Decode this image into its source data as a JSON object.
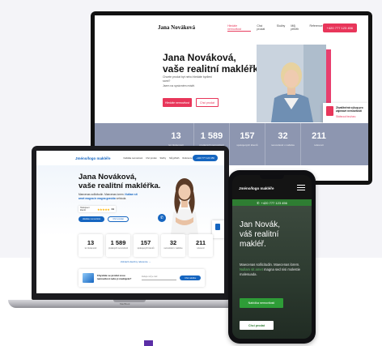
{
  "monitor": {
    "logo": "Jana Nováková",
    "nav": [
      "Hledáte nemovitost",
      "Chci prodat",
      "Služby",
      "Můj příběh",
      "Reference"
    ],
    "phone": "+420 777 123 456",
    "heading_line1": "Jana Nováková,",
    "heading_line2": "vaše realitní makléřka.",
    "sub_line1": "Chcete prodat byt nebo hledáte bydlení sami?",
    "sub_line2": "Jsem na správném místě.",
    "btn_primary": "Hledáte nemovitost",
    "btn_secondary": "Chci prodat",
    "card_text": "Zkvalitněná výkup pro zajímavé nemovitosti",
    "card_link": "Stáhnout brožuru",
    "stats": [
      {
        "value": "13",
        "label": "let zkušeností"
      },
      {
        "value": "1 589",
        "label": "prodaných nemovitostí"
      },
      {
        "value": "157",
        "label": "spokojených klientů"
      },
      {
        "value": "32",
        "label": "nemovitostí v nabídce"
      },
      {
        "value": "211",
        "label": "referencí"
      }
    ]
  },
  "laptop": {
    "logo": "Jméno/logo makléře",
    "nav": [
      "Nabídka nemovitostí",
      "Chci prodat",
      "Služby",
      "Můj příběh",
      "Reference"
    ],
    "phone": "+420 777 123 456",
    "heading_line1": "Jana Nováková,",
    "heading_line2": "vaše realitní makléřka.",
    "sub_line1": "Maecenas sollicitudin. Maecenas lorem.",
    "sub_highlight": "Nullam sit amet magna in magna gravida",
    "sub_line2": "vehicula.",
    "rating_text": "Hodnocení klientů",
    "stars": "★★★★★",
    "rating_value": "4.9",
    "btn_primary": "Hledáte nemovitost",
    "btn_secondary": "Chci prodat",
    "stats": [
      {
        "value": "13",
        "label": "let zkušeností"
      },
      {
        "value": "1 589",
        "label": "prodaných nemovitostí"
      },
      {
        "value": "157",
        "label": "spokojených klientů"
      },
      {
        "value": "32",
        "label": "nemovitostí v nabídce"
      },
      {
        "value": "211",
        "label": "referencí"
      }
    ],
    "more_link": "Zobrazit všechny reference →",
    "banner_title": "Chystáte se prodat svou nemovitost nebo ji zvažujete?",
    "banner_input": "Zadejte svůj e-mail",
    "banner_button": "Chci nabídku",
    "brand": "MacBook"
  },
  "phone": {
    "logo": "Jméno/logo makléře",
    "phone_icon": "phone-icon",
    "phone": "+420 777 123 456",
    "heading_line1": "Jan Novák,",
    "heading_line2": "váš realitní",
    "heading_line3": "makléř.",
    "text_part1": "Maecenas sollicitudin. Maecenas lorem.",
    "text_green": "Nullam sit amet",
    "text_part2": "magna sed nisi molestie malesuada.",
    "btn_primary": "Nabídka nemovitostí",
    "btn_secondary": "Chci prodat"
  },
  "colors": {
    "monitor_accent": "#e8365a",
    "laptop_accent": "#1565c0",
    "phone_accent": "#2e7d32"
  }
}
